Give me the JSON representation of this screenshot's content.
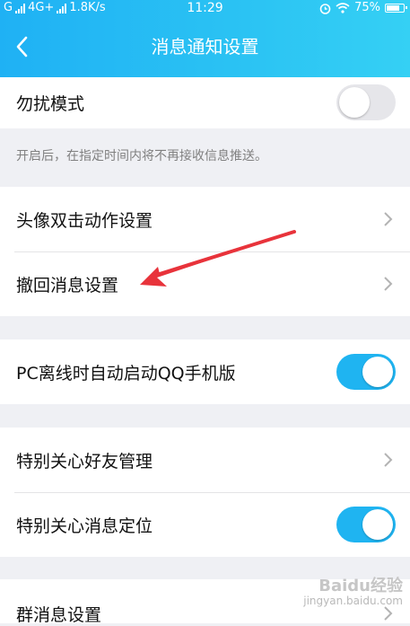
{
  "status_bar": {
    "carrier1": "G",
    "carrier2": "4G+",
    "speed": "1.8K/s",
    "time": "11:29",
    "battery": "75%"
  },
  "nav": {
    "back_icon": "chevron-left-icon",
    "title": "消息通知设置"
  },
  "dnd": {
    "label": "勿扰模式",
    "enabled": false,
    "hint": "开启后，在指定时间内将不再接收信息推送。"
  },
  "section1": {
    "items": [
      {
        "label": "头像双击动作设置",
        "icon": "chevron-right-icon"
      },
      {
        "label": "撤回消息设置",
        "icon": "chevron-right-icon"
      }
    ]
  },
  "pc_offline": {
    "label": "PC离线时自动启动QQ手机版",
    "enabled": true
  },
  "section3": {
    "items": [
      {
        "label": "特别关心好友管理",
        "icon": "chevron-right-icon"
      },
      {
        "label": "特别关心消息定位",
        "enabled": true
      }
    ]
  },
  "section4": {
    "items": [
      {
        "label": "群消息设置",
        "icon": "chevron-right-icon"
      }
    ]
  },
  "watermark": {
    "main": "Baidu经验",
    "sub": "jingyan.baidu.com"
  },
  "colors": {
    "accent": "#1fb4f1",
    "annotation_arrow": "#e8333b"
  }
}
